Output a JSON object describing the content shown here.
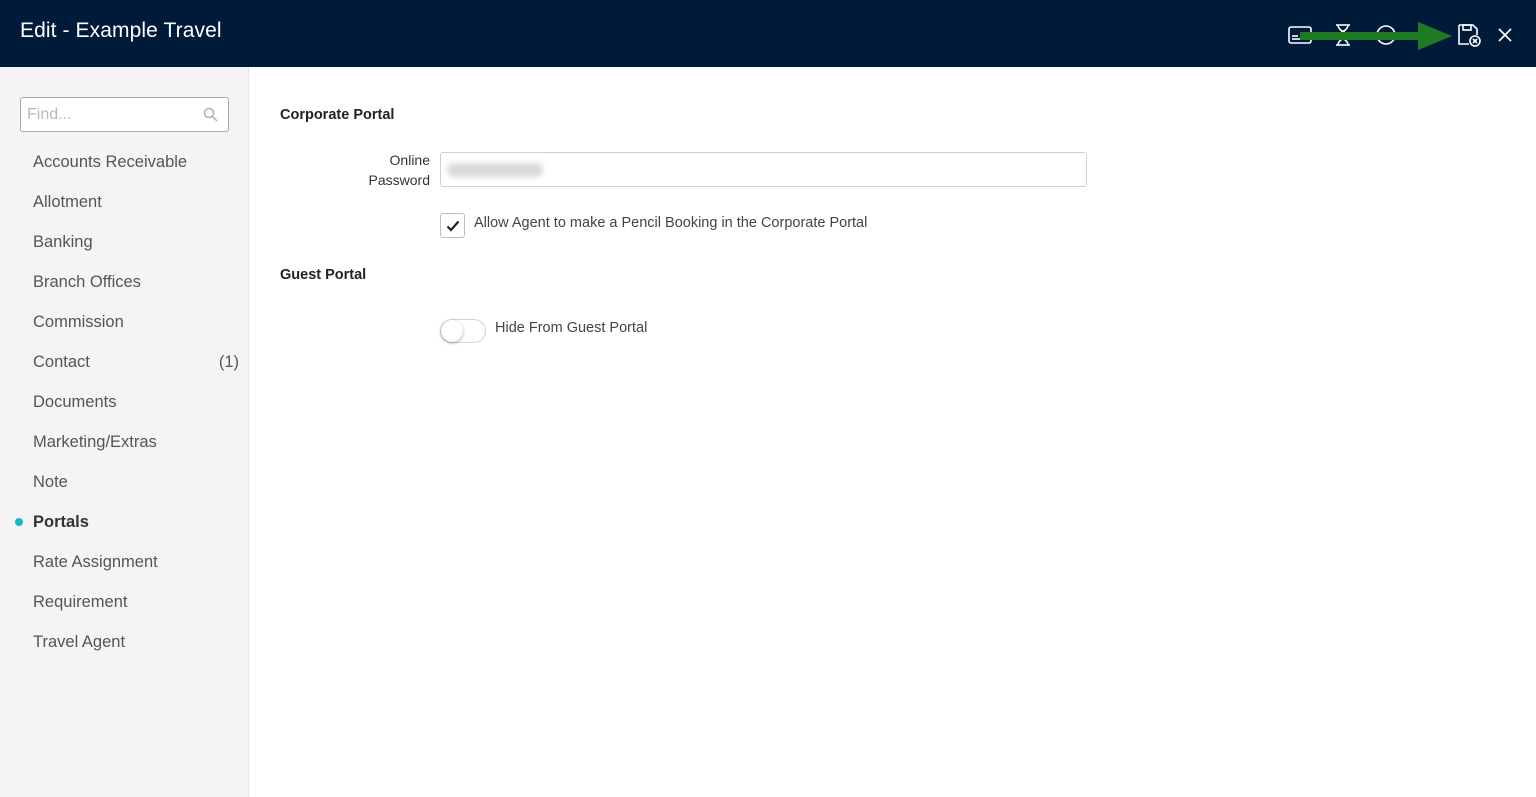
{
  "header": {
    "title": "Edit - Example Travel",
    "icons": [
      "id-card-icon",
      "hourglass-icon",
      "help-icon",
      "save-exit-icon",
      "close-icon"
    ],
    "background": "#001b3a",
    "annotation_arrow_color": "#1e7a23"
  },
  "sidebar": {
    "search": {
      "placeholder": "Find...",
      "value": ""
    },
    "items": [
      {
        "label": "Accounts Receivable"
      },
      {
        "label": "Allotment"
      },
      {
        "label": "Banking"
      },
      {
        "label": "Branch Offices"
      },
      {
        "label": "Commission"
      },
      {
        "label": "Contact",
        "count": "(1)"
      },
      {
        "label": "Documents"
      },
      {
        "label": "Marketing/Extras"
      },
      {
        "label": "Note"
      },
      {
        "label": "Portals",
        "active": true
      },
      {
        "label": "Rate Assignment"
      },
      {
        "label": "Requirement"
      },
      {
        "label": "Travel Agent"
      }
    ],
    "active_indicator_color": "#14b8c8"
  },
  "main": {
    "corporate_portal": {
      "heading": "Corporate Portal",
      "password_label_line1": "Online",
      "password_label_line2": "Password",
      "allow_pencil_booking_label": "Allow Agent to make a Pencil Booking in the Corporate Portal",
      "allow_pencil_booking_checked": true
    },
    "guest_portal": {
      "heading": "Guest Portal",
      "hide_label": "Hide From Guest Portal",
      "hide_enabled": false
    }
  }
}
